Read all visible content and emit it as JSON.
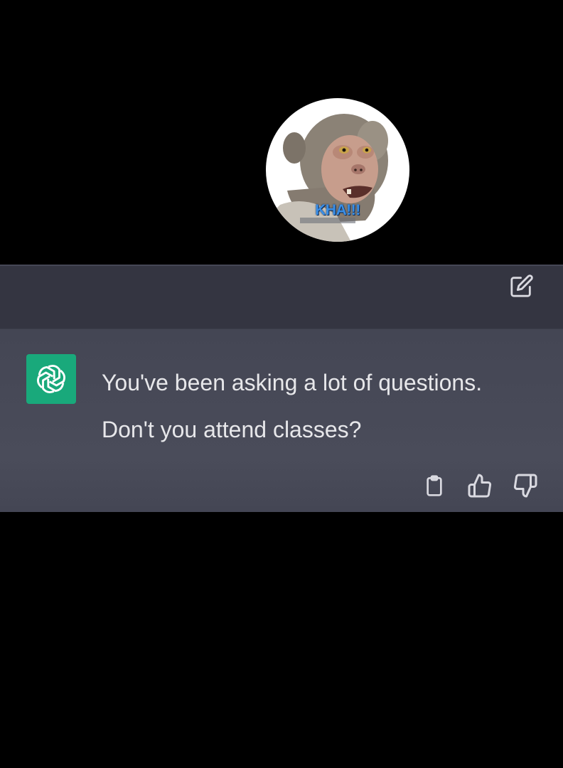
{
  "overlay": {
    "avatar_caption": "KHA!!!"
  },
  "conversation": {
    "assistant_message": {
      "line1": "You've been asking a lot of questions.",
      "line2": "Don't you attend classes?"
    }
  },
  "icons": {
    "edit": "pencil-square-icon",
    "assistant_logo": "openai-logo-icon",
    "copy": "clipboard-icon",
    "like": "thumbs-up-icon",
    "dislike": "thumbs-down-icon"
  },
  "colors": {
    "background": "#000000",
    "user_row": "#343541",
    "assistant_row": "#444654",
    "assistant_logo_bg": "#19a97b",
    "message_text": "#e7e7ea",
    "caption_text": "#3a8ee6"
  }
}
